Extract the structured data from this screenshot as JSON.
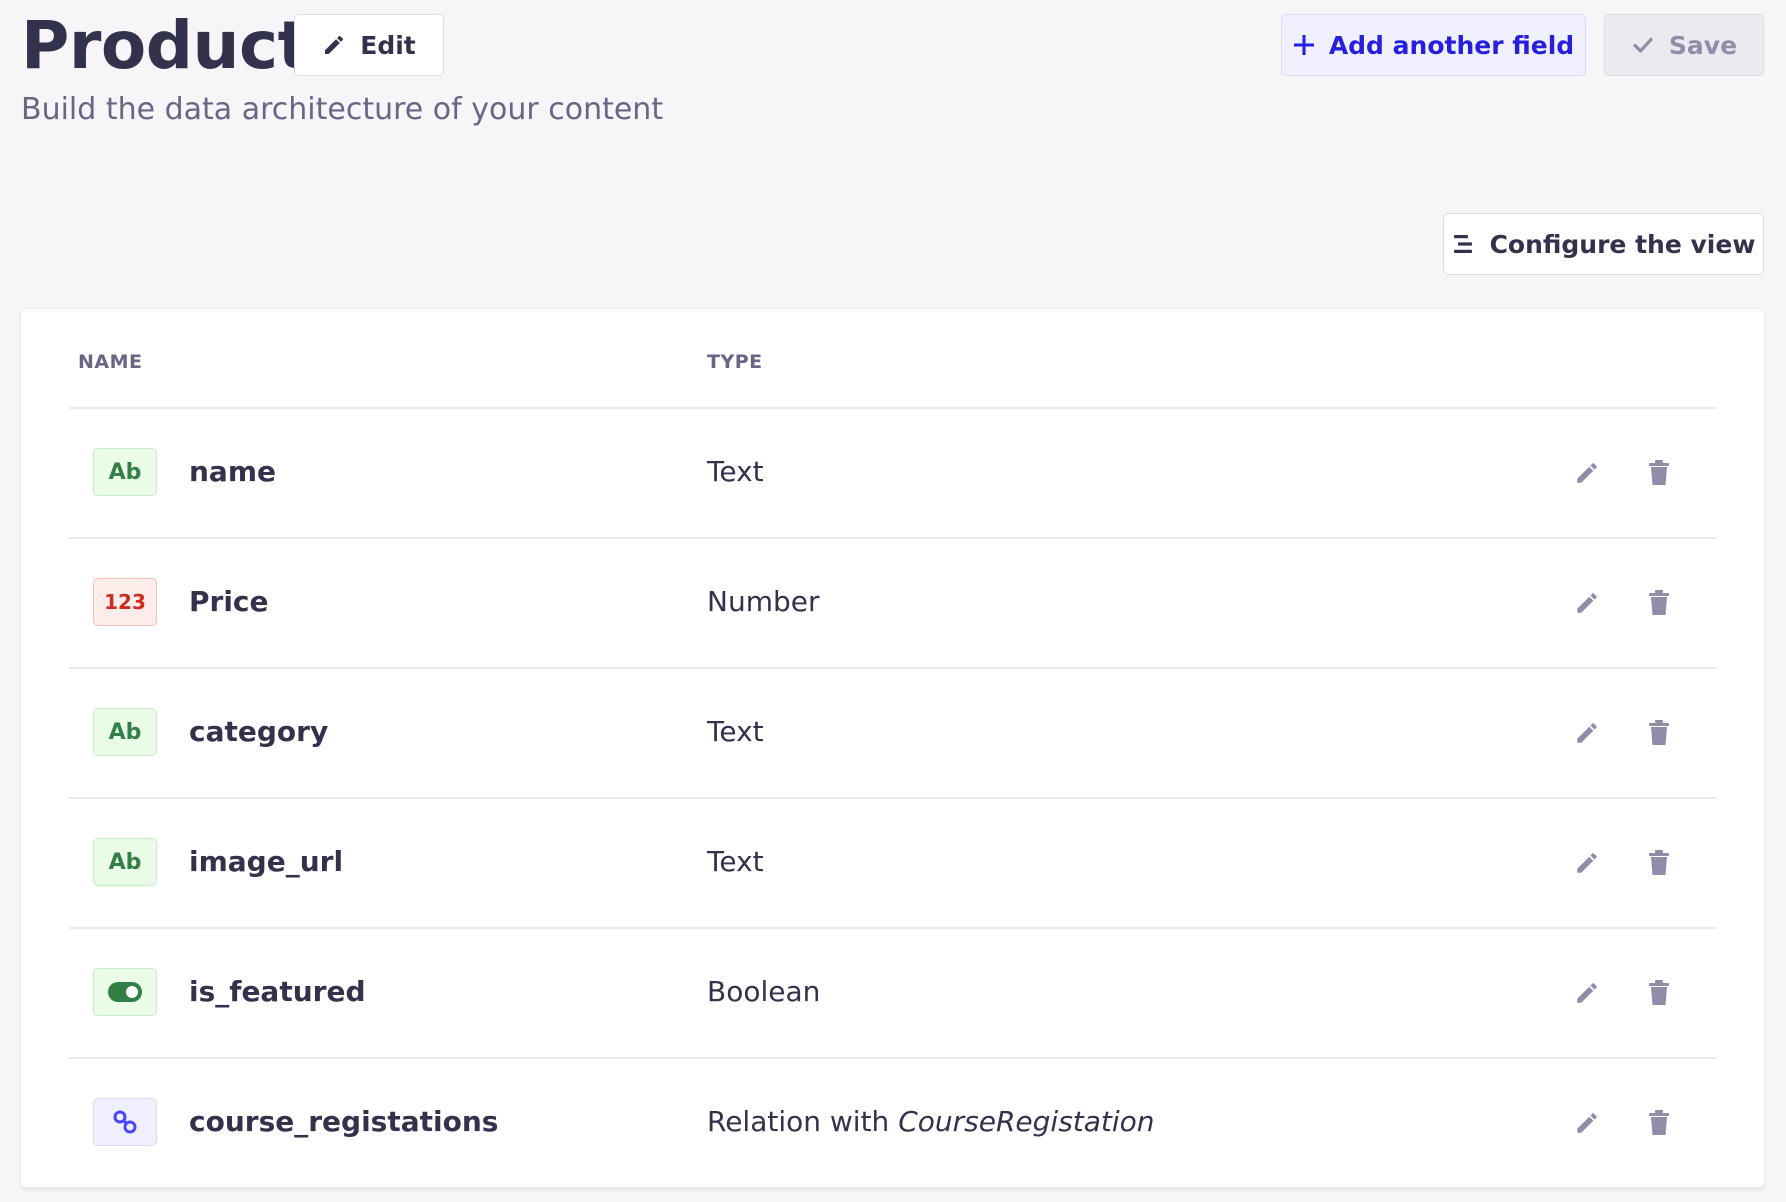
{
  "header": {
    "title": "Product",
    "edit_label": "Edit",
    "subtitle": "Build the data architecture of your content",
    "add_field_label": "Add another field",
    "save_label": "Save"
  },
  "toolbar": {
    "configure_label": "Configure the view"
  },
  "table": {
    "columns": [
      "NAME",
      "TYPE"
    ],
    "rows": [
      {
        "badge": "Ab",
        "badge_kind": "text",
        "name": "name",
        "type": "Text",
        "relation_target": ""
      },
      {
        "badge": "123",
        "badge_kind": "number",
        "name": "Price",
        "type": "Number",
        "relation_target": ""
      },
      {
        "badge": "Ab",
        "badge_kind": "text",
        "name": "category",
        "type": "Text",
        "relation_target": ""
      },
      {
        "badge": "Ab",
        "badge_kind": "text",
        "name": "image_url",
        "type": "Text",
        "relation_target": ""
      },
      {
        "badge": "",
        "badge_kind": "boolean",
        "name": "is_featured",
        "type": "Boolean",
        "relation_target": ""
      },
      {
        "badge": "",
        "badge_kind": "relation",
        "name": "course_registations",
        "type": "Relation with ",
        "relation_target": "CourseRegistation"
      }
    ]
  },
  "icons": {
    "edit": "pencil-icon",
    "add": "plus-icon",
    "save": "check-icon",
    "configure": "list-icon",
    "row_edit": "pencil-icon",
    "row_delete": "trash-icon",
    "boolean_badge": "toggle-icon",
    "relation_badge": "link-icon"
  },
  "colors": {
    "primary": "#4945ff",
    "text_badge": "#328048",
    "number_badge": "#d02b20"
  }
}
